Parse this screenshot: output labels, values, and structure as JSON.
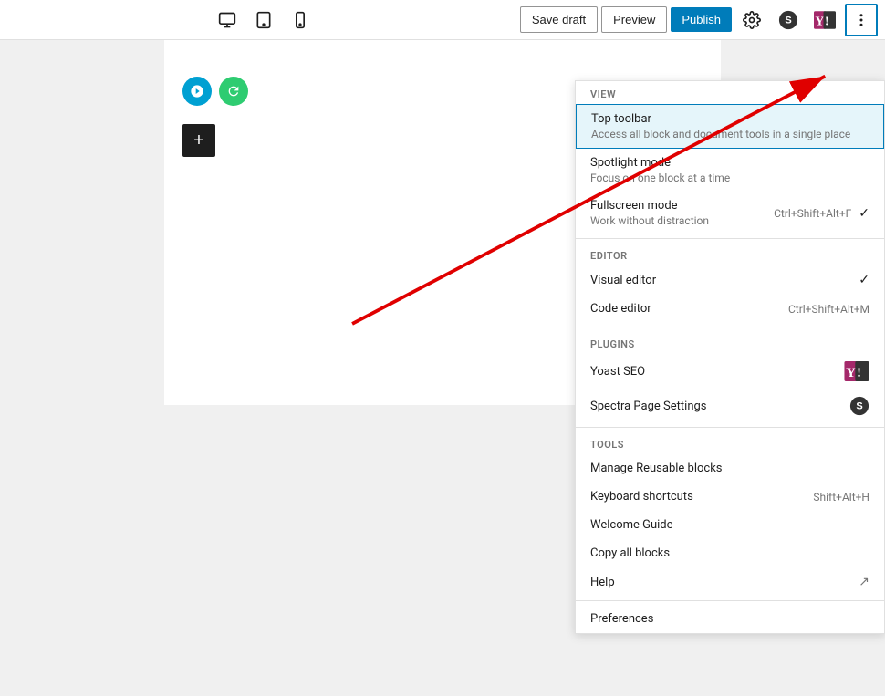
{
  "toolbar": {
    "save_draft_label": "Save draft",
    "preview_label": "Preview",
    "publish_label": "Publish",
    "view_icons": [
      {
        "name": "desktop-icon",
        "label": "Desktop"
      },
      {
        "name": "tablet-icon",
        "label": "Tablet"
      },
      {
        "name": "mobile-icon",
        "label": "Mobile"
      }
    ],
    "gear_icon": "⚙",
    "spectra_icon": "S",
    "three_dots_icon": "⋮"
  },
  "dropdown": {
    "sections": [
      {
        "label": "VIEW",
        "items": [
          {
            "title": "Top toolbar",
            "desc": "Access all block and document tools in a single place",
            "shortcut": "",
            "checked": true,
            "active": true
          },
          {
            "title": "Spotlight mode",
            "desc": "Focus on one block at a time",
            "shortcut": "",
            "checked": false,
            "active": false
          },
          {
            "title": "Fullscreen mode",
            "desc": "Work without distraction",
            "shortcut": "Ctrl+Shift+Alt+F",
            "checked": true,
            "active": false
          }
        ]
      },
      {
        "label": "EDITOR",
        "items": [
          {
            "title": "Visual editor",
            "desc": "",
            "shortcut": "",
            "checked": true,
            "active": false
          },
          {
            "title": "Code editor",
            "desc": "",
            "shortcut": "Ctrl+Shift+Alt+M",
            "checked": false,
            "active": false
          }
        ]
      },
      {
        "label": "PLUGINS",
        "items": [
          {
            "title": "Yoast SEO",
            "desc": "",
            "shortcut": "",
            "checked": false,
            "active": false,
            "icon": "yoast"
          },
          {
            "title": "Spectra Page Settings",
            "desc": "",
            "shortcut": "",
            "checked": false,
            "active": false,
            "icon": "spectra"
          }
        ]
      },
      {
        "label": "TOOLS",
        "items": [
          {
            "title": "Manage Reusable blocks",
            "desc": "",
            "shortcut": "",
            "checked": false,
            "active": false
          },
          {
            "title": "Keyboard shortcuts",
            "desc": "",
            "shortcut": "Shift+Alt+H",
            "checked": false,
            "active": false
          },
          {
            "title": "Welcome Guide",
            "desc": "",
            "shortcut": "",
            "checked": false,
            "active": false
          },
          {
            "title": "Copy all blocks",
            "desc": "",
            "shortcut": "",
            "checked": false,
            "active": false
          },
          {
            "title": "Help",
            "desc": "",
            "shortcut": "",
            "checked": false,
            "active": false,
            "icon": "external"
          }
        ]
      },
      {
        "label": "",
        "items": [
          {
            "title": "Preferences",
            "desc": "",
            "shortcut": "",
            "checked": false,
            "active": false
          }
        ]
      }
    ]
  },
  "canvas": {
    "add_block_label": "+"
  }
}
